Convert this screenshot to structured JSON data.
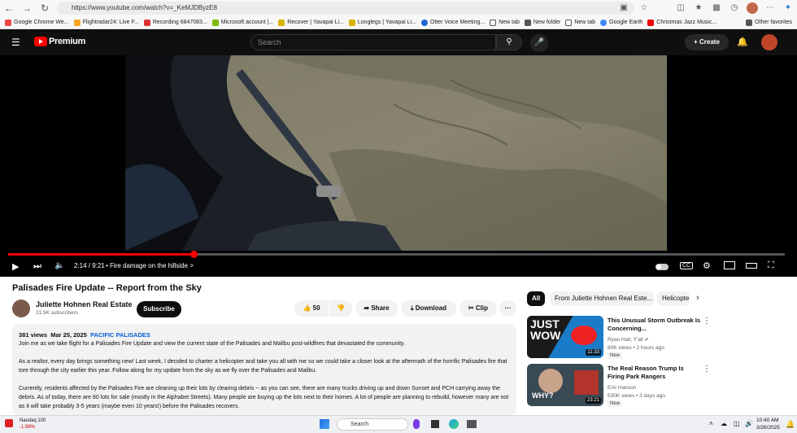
{
  "browser": {
    "url": "https://www.youtube.com/watch?v=_KeMJDByzE8",
    "bookmarks": [
      "Google Chrome We...",
      "Flightradar24: Live F...",
      "Recording 6847083...",
      "Microsoft account |...",
      "Recover | Yavapai Li...",
      "Longlegs | Yavapai Li...",
      "Otter Voice Meeting...",
      "New tab",
      "New folder",
      "New tab",
      "Google Earth",
      "Christmas Jazz Music..."
    ],
    "other_favorites": "Other favorites"
  },
  "header": {
    "logo": "Premium",
    "search_placeholder": "Search",
    "create_label": "Create"
  },
  "player": {
    "time": "2:14 / 9:21",
    "chapter": "• Fire damage on the hillside",
    "chapter_chevron": ">",
    "progress": 0.239
  },
  "video": {
    "title": "Palisades Fire Update -- Report from the Sky",
    "channel": "Juliette Hohnen Real Estate",
    "subscribers": "21.5K subscribers",
    "subscribe_label": "Subscribe",
    "likes": "50",
    "share_label": "Share",
    "download_label": "Download",
    "clip_label": "Clip",
    "more_label": "···"
  },
  "description": {
    "views": "381 views",
    "date": "Mar 25, 2025",
    "hashtag": "PACIFIC PALISADES",
    "p1": "Join me as we take flight for a Palisades Fire Update and view the current state of the Palisades and Malibu post-wildfires that devastated the community.",
    "p2": "As a realtor, every day brings something new! Last week, I decided to charter a helicopter and take you all with me so we could take a closer look at the aftermath of the horrific Palisades fire that tore through the city earlier this year. Follow along for my update from the sky as we fly over the Palisades and Malibu.",
    "p3": "Currently, residents affected by the Palisades Fire are cleaning up their lots by clearing debris -- as you can see, there are many trucks driving up and down Sunset and PCH carrying away the debris. As of today, there are 80 lots for sale (mostly in the Alphabet Streets). Many people are buying up the lots next to their homes. A lot of people are planning to rebuild, however many are not as it will take probably 3-5 years (maybe even 10 years!) before the Palisades recovers."
  },
  "sidebar": {
    "chips": [
      "All",
      "From Juliette Hohnen Real Este...",
      "Helicopte"
    ],
    "recommendations": [
      {
        "title": "This Unusual Storm Outbreak Is Concerning...",
        "channel": "Ryan Hall, Y'all",
        "verified": "✔",
        "meta": "80K views • 2 hours ago",
        "badge": "New",
        "duration": "11:33",
        "thumb_text": "JUST WOW"
      },
      {
        "title": "The Real Reason Trump Is Firing Park Rangers",
        "channel": "Eric Hanson",
        "meta": "530K views • 3 days ago",
        "badge": "New",
        "duration": "23:21",
        "thumb_text": "WHY?"
      }
    ]
  },
  "taskbar": {
    "ticker_name": "Nasdaq 100",
    "ticker_change": "-1.98%",
    "search_placeholder": "Search",
    "time": "10:40 AM",
    "date": "3/26/2025"
  }
}
